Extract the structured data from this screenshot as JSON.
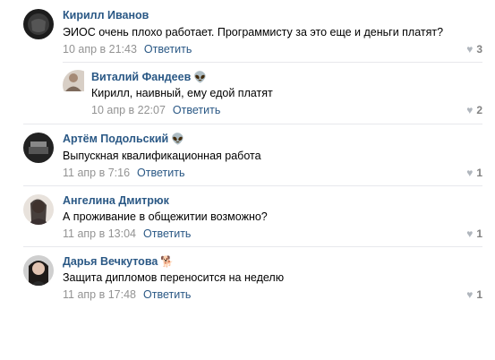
{
  "comments": [
    {
      "author": "Кирилл Иванов",
      "emoji": "",
      "text": "ЭИОС очень плохо работает. Программисту за это еще и деньги платят?",
      "date": "10 апр в 21:43",
      "reply": "Ответить",
      "likes": "3"
    },
    {
      "author": "Виталий Фандеев",
      "emoji": "👽",
      "text": "Кирилл, наивный, ему едой платят",
      "date": "10 апр в 22:07",
      "reply": "Ответить",
      "likes": "2"
    },
    {
      "author": "Артём Подольский",
      "emoji": "👽",
      "text": "Выпускная квалификационная работа",
      "date": "11 апр в 7:16",
      "reply": "Ответить",
      "likes": "1"
    },
    {
      "author": "Ангелина Дмитрюк",
      "emoji": "",
      "text": "А проживание в общежитии возможно?",
      "date": "11 апр в 13:04",
      "reply": "Ответить",
      "likes": "1"
    },
    {
      "author": "Дарья Вечкутова",
      "emoji": "🐕",
      "text": "Защита дипломов переносится на неделю",
      "date": "11 апр в 17:48",
      "reply": "Ответить",
      "likes": "1"
    }
  ],
  "colors": {
    "link": "#2a5885",
    "meta": "#939393",
    "divider": "#e7e8ec"
  },
  "icons": {
    "like": "heart-icon"
  }
}
